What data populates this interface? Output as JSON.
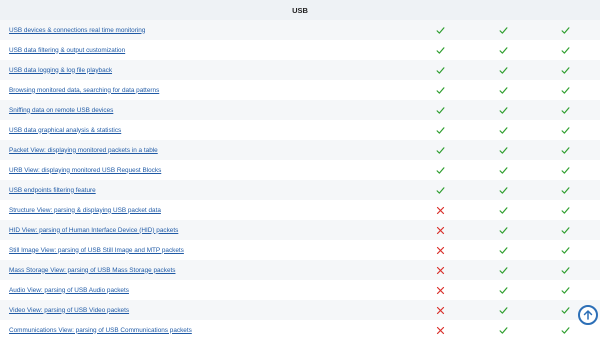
{
  "table": {
    "section_title": "USB",
    "rows": [
      {
        "label": "USB devices & connections real time monitoring",
        "marks": [
          "check",
          "check",
          "check"
        ]
      },
      {
        "label": "USB data filtering & output customization",
        "marks": [
          "check",
          "check",
          "check"
        ]
      },
      {
        "label": "USB data logging & log file playback",
        "marks": [
          "check",
          "check",
          "check"
        ]
      },
      {
        "label": "Browsing monitored data, searching for data patterns",
        "marks": [
          "check",
          "check",
          "check"
        ]
      },
      {
        "label": "Sniffing data on remote USB devices",
        "marks": [
          "check",
          "check",
          "check"
        ]
      },
      {
        "label": "USB data graphical analysis & statistics",
        "marks": [
          "check",
          "check",
          "check"
        ]
      },
      {
        "label": "Packet View: displaying monitored packets in a table",
        "marks": [
          "check",
          "check",
          "check"
        ]
      },
      {
        "label": "URB View: displaying monitored USB Request Blocks",
        "marks": [
          "check",
          "check",
          "check"
        ]
      },
      {
        "label": "USB endpoints filtering feature",
        "marks": [
          "check",
          "check",
          "check"
        ]
      },
      {
        "label": "Structure View: parsing & displaying USB packet data",
        "marks": [
          "cross",
          "check",
          "check"
        ]
      },
      {
        "label": "HID View: parsing of Human Interface Device (HID) packets",
        "marks": [
          "cross",
          "check",
          "check"
        ]
      },
      {
        "label": "Still Image View: parsing of USB Still Image and MTP packets",
        "marks": [
          "cross",
          "check",
          "check"
        ]
      },
      {
        "label": "Mass Storage View: parsing of USB Mass Storage packets",
        "marks": [
          "cross",
          "check",
          "check"
        ]
      },
      {
        "label": "Audio View: parsing of USB Audio packets",
        "marks": [
          "cross",
          "check",
          "check"
        ]
      },
      {
        "label": "Video View: parsing of USB Video packets",
        "marks": [
          "cross",
          "check",
          "check"
        ]
      },
      {
        "label": "Communications View: parsing of USB Communications packets",
        "marks": [
          "cross",
          "check",
          "check"
        ]
      }
    ]
  },
  "icons": {
    "check": "check-icon",
    "cross": "cross-icon",
    "scroll_top": "arrow-up-icon"
  },
  "colors": {
    "check": "#2e9e2e",
    "cross": "#d9302b",
    "link": "#1f5aa6",
    "scroll_button": "#2c6fb7"
  }
}
